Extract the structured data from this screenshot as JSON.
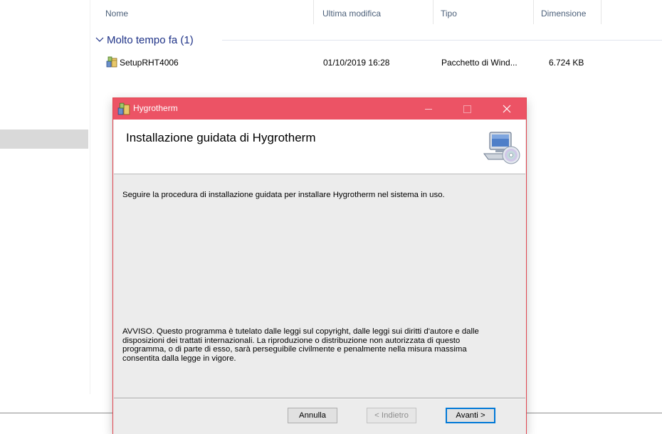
{
  "explorer": {
    "columns": {
      "name": "Nome",
      "modified": "Ultima modifica",
      "type": "Tipo",
      "size": "Dimensione"
    },
    "group": {
      "title": "Molto tempo fa (1)"
    },
    "files": [
      {
        "name": "SetupRHT4006",
        "modified": "01/10/2019 16:28",
        "type": "Pacchetto di Wind...",
        "size": "6.724 KB"
      }
    ]
  },
  "dialog": {
    "window_title": "Hygrotherm",
    "banner_title": "Installazione guidata di Hygrotherm",
    "intro": "Seguire la procedura di installazione guidata per installare Hygrotherm nel sistema in uso.",
    "warning_lines": [
      "AVVISO. Questo programma è tutelato dalle leggi sul copyright, dalle leggi sui diritti d'autore e dalle",
      "disposizioni dei trattati internazionali. La riproduzione o distribuzione non autorizzata di questo",
      "programma, o di parte di esso, sarà perseguibile civilmente e penalmente nella misura massima",
      "consentita dalla legge in vigore."
    ],
    "buttons": {
      "cancel": "Annulla",
      "back": "< Indietro",
      "next": "Avanti >"
    },
    "titlebar_close": "✕"
  },
  "colors": {
    "titlebar": "#ec5365",
    "dialog_bg": "#ececec",
    "group_header": "#1e3287",
    "default_button_border": "#0078d7"
  }
}
